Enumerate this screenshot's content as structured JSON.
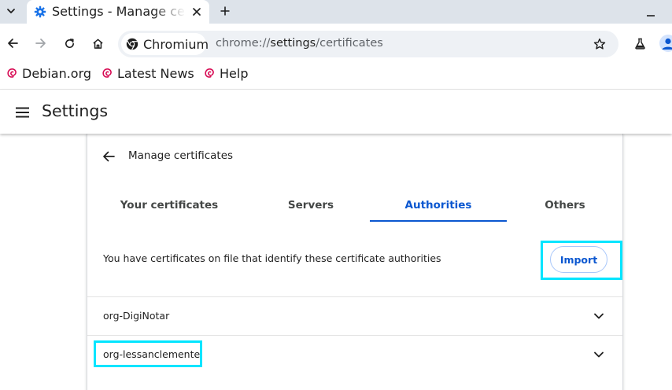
{
  "browser": {
    "tab": {
      "title": "Settings - Manage certificates"
    },
    "omnibox": {
      "chip_label": "Chromium",
      "url_scheme": "chrome://",
      "url_host": "settings",
      "url_path": "/certificates"
    },
    "bookmarks": [
      {
        "label": "Debian.org",
        "icon": "debian-swirl-icon"
      },
      {
        "label": "Latest News",
        "icon": "debian-swirl-icon"
      },
      {
        "label": "Help",
        "icon": "debian-swirl-icon"
      }
    ]
  },
  "settings": {
    "title": "Settings",
    "page_subtitle": "Manage certificates",
    "tabs": [
      {
        "label": "Your certificates",
        "active": false
      },
      {
        "label": "Servers",
        "active": false
      },
      {
        "label": "Authorities",
        "active": true
      },
      {
        "label": "Others",
        "active": false
      }
    ],
    "description": "You have certificates on file that identify these certificate authorities",
    "import_label": "Import",
    "certificates": [
      {
        "name": "org-DigiNotar"
      },
      {
        "name": "org-lessanclemente"
      }
    ]
  },
  "colors": {
    "accent": "#0b57d0",
    "tabstrip": "#dde3ea",
    "omnibox": "#eef1f5",
    "highlight": "#00e5ff",
    "debian": "#d70a53"
  }
}
